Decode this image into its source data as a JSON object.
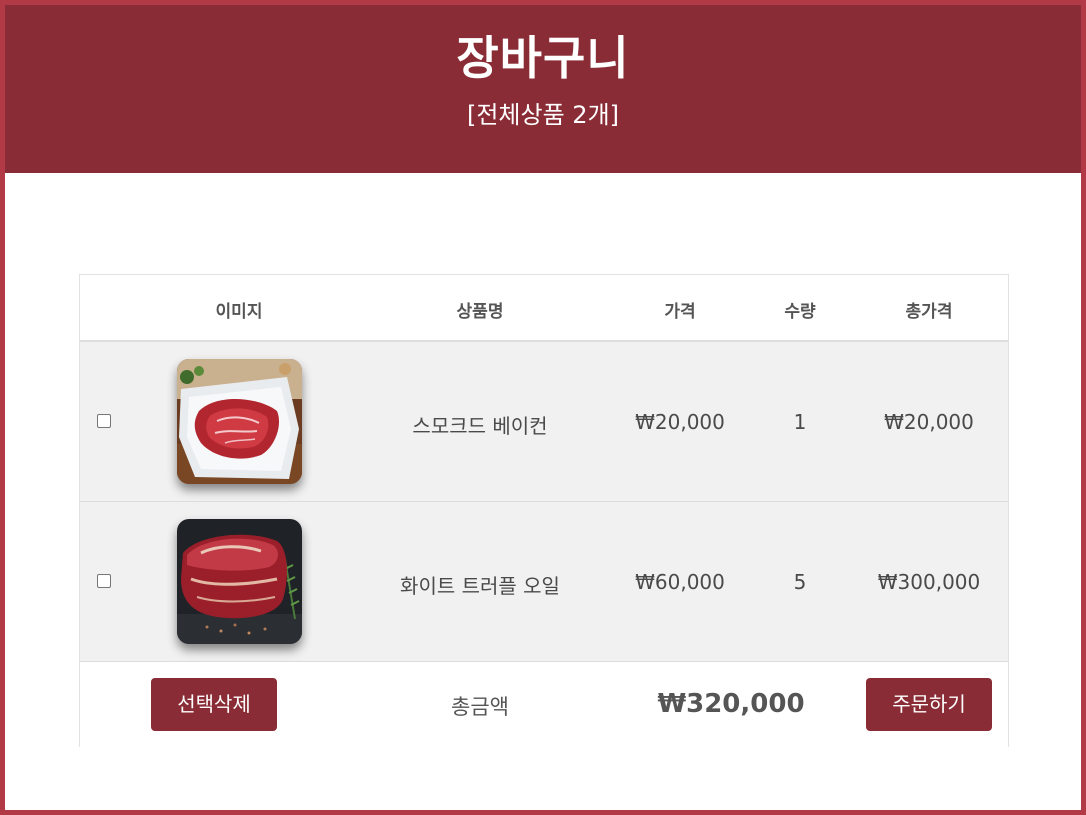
{
  "header": {
    "title": "장바구니",
    "subtitle": "[전체상품 2개]"
  },
  "table": {
    "columns": [
      "이미지",
      "상품명",
      "가격",
      "수량",
      "총가격"
    ],
    "rows": [
      {
        "checked": false,
        "image": "beef-steak-on-plate",
        "name": "스모크드 베이컨",
        "price": "₩20,000",
        "quantity": "1",
        "total": "₩20,000"
      },
      {
        "checked": false,
        "image": "thick-beef-steak-on-slate",
        "name": "화이트 트러플 오일",
        "price": "₩60,000",
        "quantity": "5",
        "total": "₩300,000"
      }
    ]
  },
  "footer": {
    "delete_label": "선택삭제",
    "total_label": "총금액",
    "total_value": "₩320,000",
    "order_label": "주문하기"
  },
  "colors": {
    "accent": "#8a2c36",
    "border": "#b23a46",
    "row_bg": "#f1f1f1"
  }
}
